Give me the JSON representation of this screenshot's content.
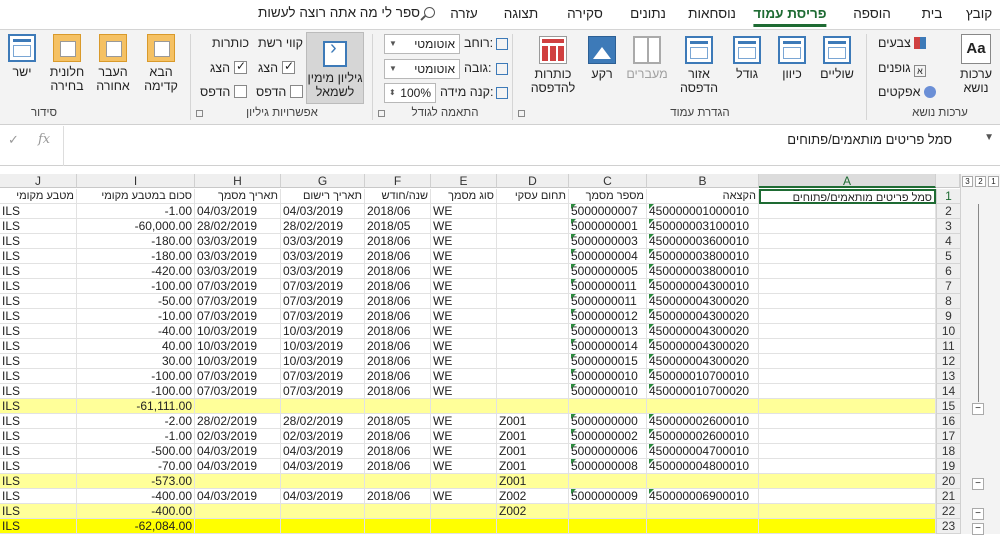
{
  "tabs": [
    "קובץ",
    "בית",
    "הוספה",
    "פריסת עמוד",
    "נוסחאות",
    "נתונים",
    "סקירה",
    "תצוגה",
    "עזרה"
  ],
  "active_tab": "פריסת עמוד",
  "tellme": "ספר לי מה אתה רוצה לעשות",
  "ribbon": {
    "groups": {
      "themes": "ערכות נושא",
      "page_setup": "הגדרת עמוד",
      "scale": "התאמה לגודל",
      "sheet_options": "אפשרויות גיליון",
      "arrange": "סידור"
    },
    "themes_btn": "ערכות\nנושא",
    "colors": "צבעים",
    "fonts": "גופנים",
    "effects": "אפקטים",
    "margins": "שוליים",
    "orientation": "כיוון",
    "size": "גודל",
    "print_area": "אזור\nהדפסה",
    "breaks": "מעברים",
    "background": "רקע",
    "print_titles": "כותרות\nלהדפסה",
    "width_label": "רוחב:",
    "width_value": "אוטומטי",
    "height_label": "גובה:",
    "height_value": "אוטומטי",
    "scale_label": "קנה מידה:",
    "scale_value": "100%",
    "gridlines": "קווי רשת",
    "headings": "כותרות",
    "view": "הצג",
    "print": "הדפס",
    "sheet_rtl": "גיליון מימין\nלשמאל",
    "bring_forward": "הבא\nקדימה",
    "send_backward": "העבר\nאחורה",
    "selection_pane": "חלונית\nבחירה",
    "align": "ישר"
  },
  "formula_bar": {
    "fx": "fx",
    "content": "סמל פריטים מותאמים/פתוחים"
  },
  "columns": [
    "A",
    "B",
    "C",
    "D",
    "E",
    "F",
    "G",
    "H",
    "I",
    "J"
  ],
  "selected_column": "A",
  "header_row": {
    "A": "סמל פריטים מותאמים/פתוחים",
    "B": "הקצאה",
    "C": "מספר מסמך",
    "D": "תחום עסקי",
    "E": "סוג מסמך",
    "F": "שנה/חודש",
    "G": "תאריך רישום",
    "H": "תאריך מסמך",
    "I": "סכום במטבע מקומי",
    "J": "מטבע מקומי"
  },
  "rows": [
    {
      "n": "2",
      "B": "450000001000010",
      "C": "5000000007",
      "D": "",
      "E": "WE",
      "F": "2018/06",
      "G": "04/03/2019",
      "H": "04/03/2019",
      "I": "-1.00",
      "J": "ILS"
    },
    {
      "n": "3",
      "B": "450000003100010",
      "C": "5000000001",
      "D": "",
      "E": "WE",
      "F": "2018/05",
      "G": "28/02/2019",
      "H": "28/02/2019",
      "I": "-60,000.00",
      "J": "ILS"
    },
    {
      "n": "4",
      "B": "450000003600010",
      "C": "5000000003",
      "D": "",
      "E": "WE",
      "F": "2018/06",
      "G": "03/03/2019",
      "H": "03/03/2019",
      "I": "-180.00",
      "J": "ILS"
    },
    {
      "n": "5",
      "B": "450000003800010",
      "C": "5000000004",
      "D": "",
      "E": "WE",
      "F": "2018/06",
      "G": "03/03/2019",
      "H": "03/03/2019",
      "I": "-180.00",
      "J": "ILS"
    },
    {
      "n": "6",
      "B": "450000003800010",
      "C": "5000000005",
      "D": "",
      "E": "WE",
      "F": "2018/06",
      "G": "03/03/2019",
      "H": "03/03/2019",
      "I": "-420.00",
      "J": "ILS"
    },
    {
      "n": "7",
      "B": "450000004300010",
      "C": "5000000011",
      "D": "",
      "E": "WE",
      "F": "2018/06",
      "G": "07/03/2019",
      "H": "07/03/2019",
      "I": "-100.00",
      "J": "ILS"
    },
    {
      "n": "8",
      "B": "450000004300020",
      "C": "5000000011",
      "D": "",
      "E": "WE",
      "F": "2018/06",
      "G": "07/03/2019",
      "H": "07/03/2019",
      "I": "-50.00",
      "J": "ILS"
    },
    {
      "n": "9",
      "B": "450000004300020",
      "C": "5000000012",
      "D": "",
      "E": "WE",
      "F": "2018/06",
      "G": "07/03/2019",
      "H": "07/03/2019",
      "I": "-10.00",
      "J": "ILS"
    },
    {
      "n": "10",
      "B": "450000004300020",
      "C": "5000000013",
      "D": "",
      "E": "WE",
      "F": "2018/06",
      "G": "10/03/2019",
      "H": "10/03/2019",
      "I": "-40.00",
      "J": "ILS"
    },
    {
      "n": "11",
      "B": "450000004300020",
      "C": "5000000014",
      "D": "",
      "E": "WE",
      "F": "2018/06",
      "G": "10/03/2019",
      "H": "10/03/2019",
      "I": "40.00",
      "J": "ILS"
    },
    {
      "n": "12",
      "B": "450000004300020",
      "C": "5000000015",
      "D": "",
      "E": "WE",
      "F": "2018/06",
      "G": "10/03/2019",
      "H": "10/03/2019",
      "I": "30.00",
      "J": "ILS"
    },
    {
      "n": "13",
      "B": "450000010700010",
      "C": "5000000010",
      "D": "",
      "E": "WE",
      "F": "2018/06",
      "G": "07/03/2019",
      "H": "07/03/2019",
      "I": "-100.00",
      "J": "ILS"
    },
    {
      "n": "14",
      "B": "450000010700020",
      "C": "5000000010",
      "D": "",
      "E": "WE",
      "F": "2018/06",
      "G": "07/03/2019",
      "H": "07/03/2019",
      "I": "-100.00",
      "J": "ILS"
    },
    {
      "n": "15",
      "B": "",
      "C": "",
      "D": "",
      "E": "",
      "F": "",
      "G": "",
      "H": "",
      "I": "-61,111.00",
      "J": "ILS",
      "hl": "light"
    },
    {
      "n": "16",
      "B": "450000002600010",
      "C": "5000000000",
      "D": "Z001",
      "E": "WE",
      "F": "2018/05",
      "G": "28/02/2019",
      "H": "28/02/2019",
      "I": "-2.00",
      "J": "ILS"
    },
    {
      "n": "17",
      "B": "450000002600010",
      "C": "5000000002",
      "D": "Z001",
      "E": "WE",
      "F": "2018/06",
      "G": "02/03/2019",
      "H": "02/03/2019",
      "I": "-1.00",
      "J": "ILS"
    },
    {
      "n": "18",
      "B": "450000004700010",
      "C": "5000000006",
      "D": "Z001",
      "E": "WE",
      "F": "2018/06",
      "G": "04/03/2019",
      "H": "04/03/2019",
      "I": "-500.00",
      "J": "ILS"
    },
    {
      "n": "19",
      "B": "450000004800010",
      "C": "5000000008",
      "D": "Z001",
      "E": "WE",
      "F": "2018/06",
      "G": "04/03/2019",
      "H": "04/03/2019",
      "I": "-70.00",
      "J": "ILS"
    },
    {
      "n": "20",
      "B": "",
      "C": "",
      "D": "Z001",
      "E": "",
      "F": "",
      "G": "",
      "H": "",
      "I": "-573.00",
      "J": "ILS",
      "hl": "light"
    },
    {
      "n": "21",
      "B": "450000006900010",
      "C": "5000000009",
      "D": "Z002",
      "E": "WE",
      "F": "2018/06",
      "G": "04/03/2019",
      "H": "04/03/2019",
      "I": "-400.00",
      "J": "ILS"
    },
    {
      "n": "22",
      "B": "",
      "C": "",
      "D": "Z002",
      "E": "",
      "F": "",
      "G": "",
      "H": "",
      "I": "-400.00",
      "J": "ILS",
      "hl": "light"
    },
    {
      "n": "23",
      "B": "",
      "C": "",
      "D": "",
      "E": "",
      "F": "",
      "G": "",
      "H": "",
      "I": "-62,084.00",
      "J": "ILS",
      "hl": "strong"
    }
  ],
  "outline": {
    "levels": [
      "1",
      "2",
      "3"
    ],
    "collapse": "−"
  },
  "colors": {
    "accent": "#1e6b33",
    "subtotal": "#ffff99",
    "grandtotal": "#ffff00"
  }
}
